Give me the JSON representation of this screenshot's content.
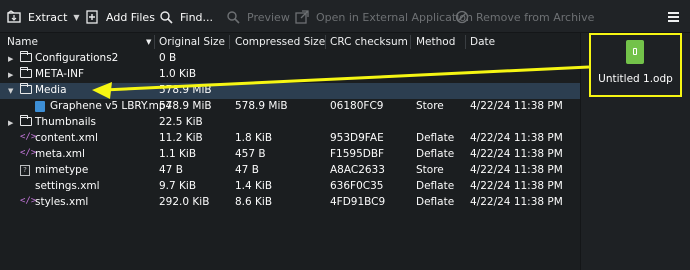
{
  "toolbar": {
    "extract_label": "Extract",
    "add_files_label": "Add Files",
    "find_label": "Find...",
    "preview_label": "Preview",
    "open_external_label": "Open in External Application",
    "remove_label": "Remove from Archive"
  },
  "columns": [
    "Name",
    "Original Size",
    "Compressed Size",
    "CRC checksum",
    "Method",
    "Date"
  ],
  "rows": [
    {
      "name": "Configurations2",
      "orig": "0 B",
      "comp": "",
      "crc": "",
      "method": "",
      "date": "",
      "icon": "folder-icon",
      "expander": "collapsed"
    },
    {
      "name": "META-INF",
      "orig": "1.0 KiB",
      "comp": "",
      "crc": "",
      "method": "",
      "date": "",
      "icon": "folder-icon",
      "expander": "collapsed"
    },
    {
      "name": "Media",
      "orig": "578.9 MiB",
      "comp": "",
      "crc": "",
      "method": "",
      "date": "",
      "icon": "folder-icon",
      "expander": "expanded"
    },
    {
      "name": "Graphene v5 LBRY.mp4",
      "orig": "578.9 MiB",
      "comp": "578.9 MiB",
      "crc": "06180FC9",
      "method": "Store",
      "date": "4/22/24 11:38 PM",
      "icon": "video-file-icon",
      "expander": ""
    },
    {
      "name": "Thumbnails",
      "orig": "22.5 KiB",
      "comp": "",
      "crc": "",
      "method": "",
      "date": "",
      "icon": "folder-icon",
      "expander": "collapsed"
    },
    {
      "name": "content.xml",
      "orig": "11.2 KiB",
      "comp": "1.8 KiB",
      "crc": "953D9FAE",
      "method": "Deflate",
      "date": "4/22/24 11:38 PM",
      "icon": "xml-file-icon",
      "expander": ""
    },
    {
      "name": "meta.xml",
      "orig": "1.1 KiB",
      "comp": "457 B",
      "crc": "F1595DBF",
      "method": "Deflate",
      "date": "4/22/24 11:38 PM",
      "icon": "xml-file-icon",
      "expander": ""
    },
    {
      "name": "mimetype",
      "orig": "47 B",
      "comp": "47 B",
      "crc": "A8AC2633",
      "method": "Store",
      "date": "4/22/24 11:38 PM",
      "icon": "unknown-file-icon",
      "expander": ""
    },
    {
      "name": "settings.xml",
      "orig": "9.7 KiB",
      "comp": "1.4 KiB",
      "crc": "636F0C35",
      "method": "Deflate",
      "date": "4/22/24 11:38 PM",
      "icon": "none",
      "expander": ""
    },
    {
      "name": "styles.xml",
      "orig": "292.0 KiB",
      "comp": "8.6 KiB",
      "crc": "4FD91BC9",
      "method": "Deflate",
      "date": "4/22/24 11:38 PM",
      "icon": "xml-file-icon",
      "expander": ""
    }
  ],
  "preview_pane": {
    "file_label": "Untitled 1.odp",
    "icon": "odp-file-icon"
  },
  "annotation": {
    "color": "#f6f613"
  }
}
